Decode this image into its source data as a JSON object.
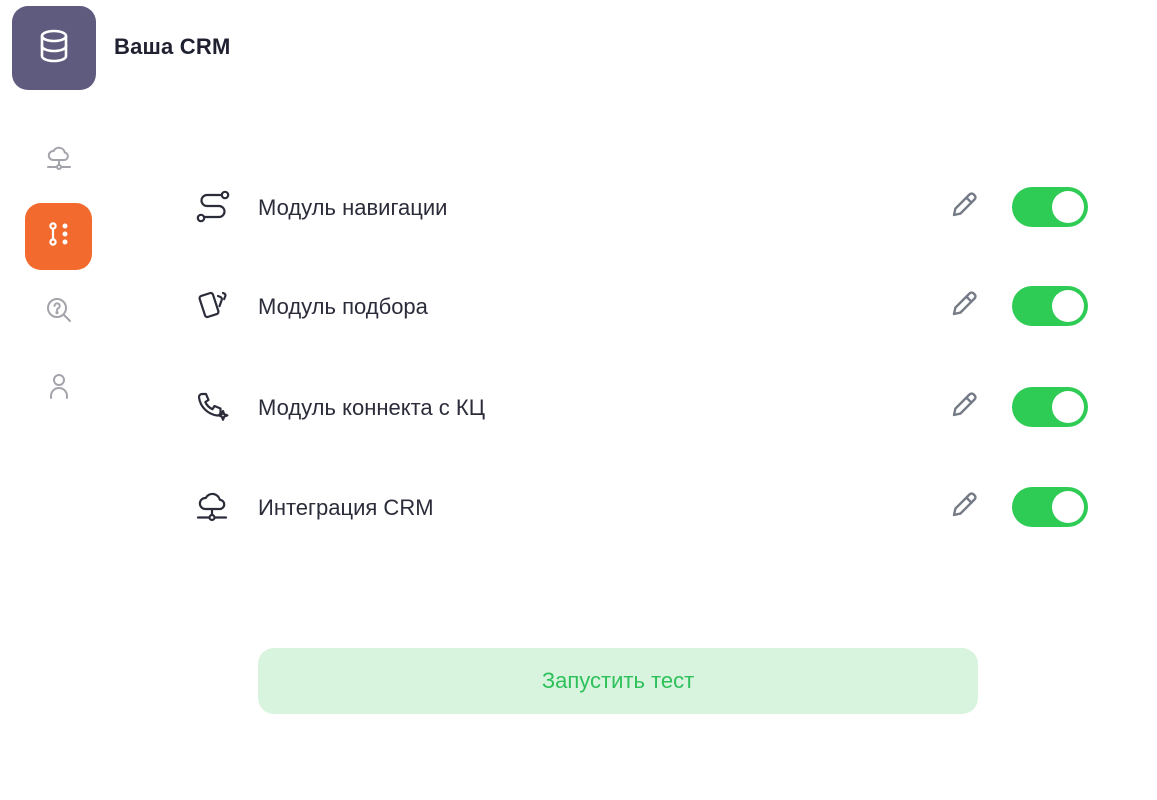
{
  "header": {
    "title": "Ваша CRM",
    "logo_icon": "database-icon",
    "logo_color": "#5f5b7e"
  },
  "sidebar": {
    "items": [
      {
        "icon": "cloud-network-icon",
        "active": false
      },
      {
        "icon": "flow-icon",
        "active": true
      },
      {
        "icon": "search-help-icon",
        "active": false
      },
      {
        "icon": "user-icon",
        "active": false
      }
    ],
    "active_color": "#f26a2e"
  },
  "modules": [
    {
      "label": "Модуль навигации",
      "icon": "route-icon",
      "enabled": true
    },
    {
      "label": "Модуль подбора",
      "icon": "cards-icon",
      "enabled": true
    },
    {
      "label": "Модуль коннекта с КЦ",
      "icon": "phone-sparkle-icon",
      "enabled": true
    },
    {
      "label": "Интеграция CRM",
      "icon": "cloud-network-icon",
      "enabled": true
    }
  ],
  "actions": {
    "run_test_label": "Запустить тест"
  },
  "colors": {
    "toggle_on": "#2ecc55",
    "cta_bg": "#d8f4df",
    "cta_text": "#2ec15a"
  }
}
